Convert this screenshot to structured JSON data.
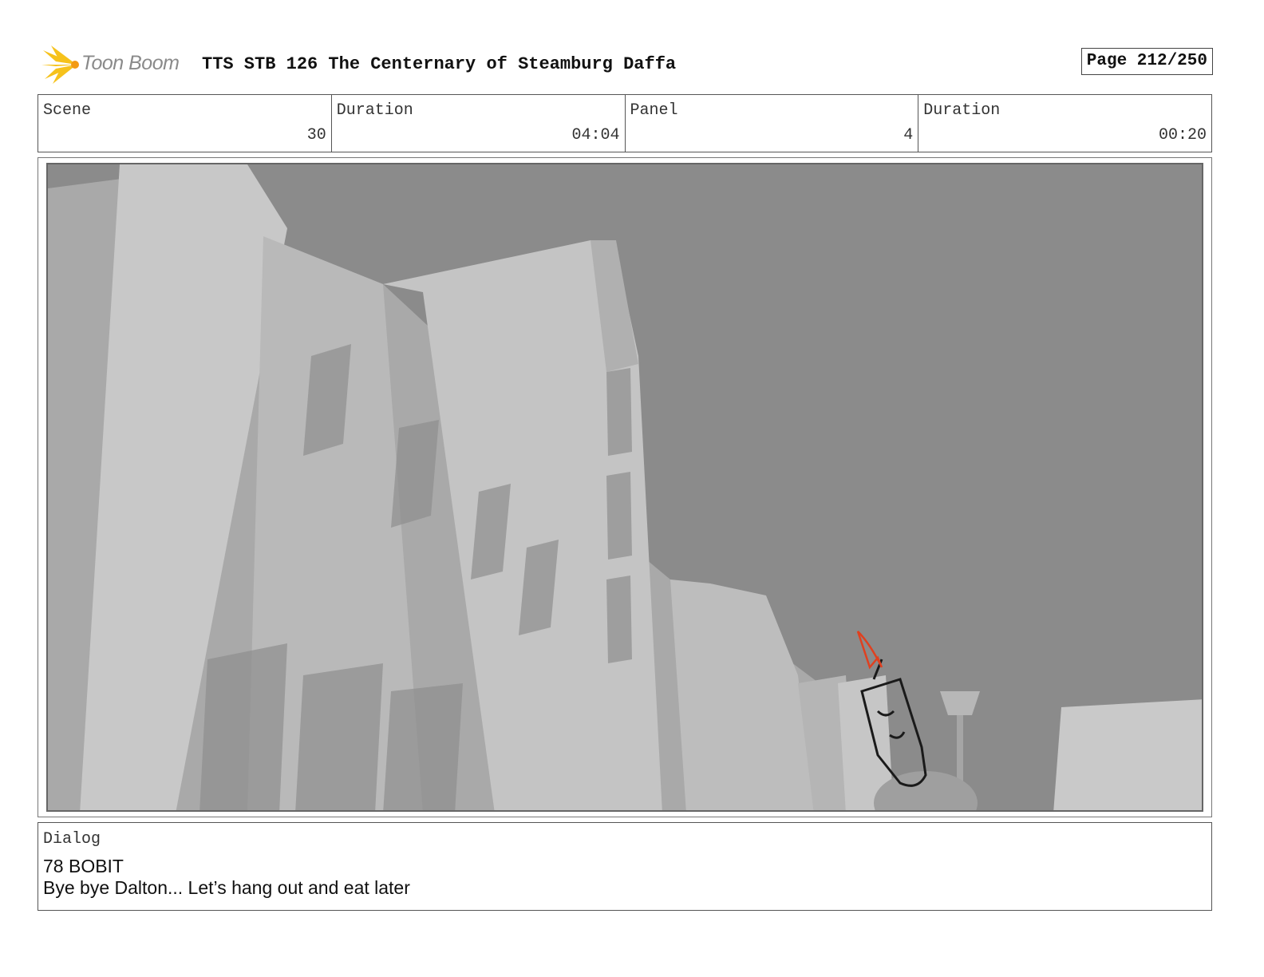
{
  "header": {
    "logo_text": "Toon Boom",
    "title": "TTS STB 126 The Centernary of Steamburg Daffa",
    "page_label": "Page 212/250"
  },
  "info": {
    "scene_label": "Scene",
    "scene_value": "30",
    "scene_duration_label": "Duration",
    "scene_duration_value": "04:04",
    "panel_label": "Panel",
    "panel_value": "4",
    "panel_duration_label": "Duration",
    "panel_duration_value": "00:20"
  },
  "dialog": {
    "label": "Dialog",
    "speaker": "78 BOBIT",
    "line": "Bye bye Dalton... Let’s hang out and eat later"
  },
  "colors": {
    "sky": "#8b8b8b",
    "building_light": "#cfcfcf",
    "building_mid": "#b3b3b3",
    "building_dark": "#9a9a9a",
    "flame": "#e0401f",
    "logo_burst": "#f6c21c"
  }
}
